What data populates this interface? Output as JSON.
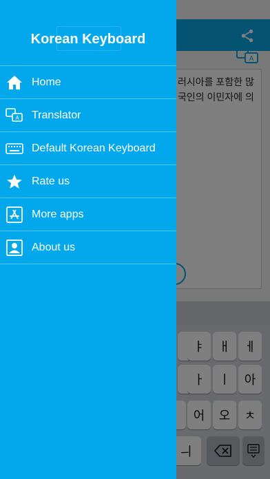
{
  "app": {
    "title": "Korean Keyboard"
  },
  "menu": {
    "items": [
      {
        "label": "Home",
        "icon": "home-icon"
      },
      {
        "label": "Translator",
        "icon": "translator-icon"
      },
      {
        "label": "Default Korean Keyboard",
        "icon": "keyboard-icon"
      },
      {
        "label": "Rate us",
        "icon": "star-icon"
      },
      {
        "label": "More apps",
        "icon": "app-store-icon"
      },
      {
        "label": "About us",
        "icon": "contact-icon"
      }
    ]
  },
  "background": {
    "text_line1": "러시아를 포함한 많",
    "text_line2": "국인의 이민자에 의",
    "keys": {
      "row1": [
        "ㅑ",
        "ㅐ",
        "ㅔ"
      ],
      "row2": [
        "ㅏ",
        "ㅣ",
        "아"
      ],
      "row3": [
        "ㆍ",
        "어",
        "오",
        "ㅊ"
      ],
      "row4": [
        "ㅢ"
      ]
    }
  },
  "colors": {
    "accent": "#03a8ec",
    "header": "#0aa7e4"
  }
}
